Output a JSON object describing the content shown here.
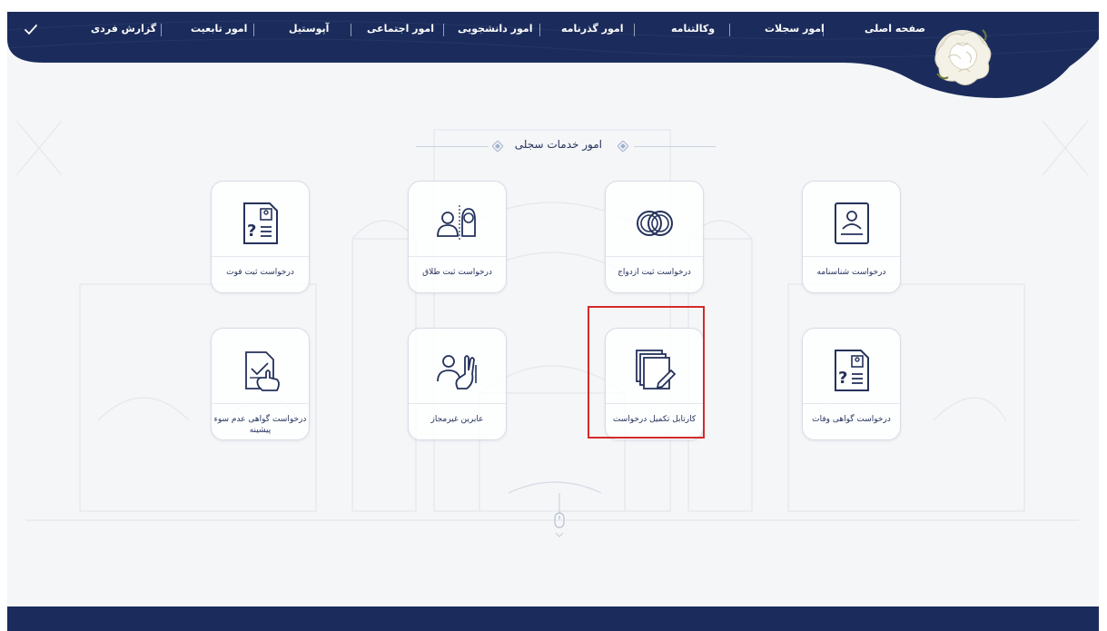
{
  "nav": {
    "items": [
      "صفحه اصلی",
      "امور سجلات",
      "وکالتنامه",
      "امور گذرنامه",
      "امور دانشجویی",
      "امور اجتماعی",
      "آپوستیل",
      "امور تابعیت",
      "گزارش فردی"
    ]
  },
  "section": {
    "title": "امور خدمات سجلی"
  },
  "cards": [
    {
      "label": "درخواست شناسنامه",
      "icon": "id-card-icon"
    },
    {
      "label": "درخواست ثبت ازدواج",
      "icon": "rings-icon"
    },
    {
      "label": "درخواست ثبت طلاق",
      "icon": "couple-icon"
    },
    {
      "label": "درخواست ثبت فوت",
      "icon": "document-question-icon"
    },
    {
      "label": "درخواست گواهی وفات",
      "icon": "document-question-icon"
    },
    {
      "label": "کارتابل تکمیل درخواست",
      "icon": "documents-edit-icon"
    },
    {
      "label": "عابرین غیرمجاز",
      "icon": "person-stop-icon"
    },
    {
      "label": "درخواست گواهی عدم سوء پیشینه",
      "icon": "document-check-hand-icon"
    }
  ],
  "colors": {
    "navy": "#1b2c5c",
    "highlight": "#d42a2a",
    "text": "#25325c"
  }
}
